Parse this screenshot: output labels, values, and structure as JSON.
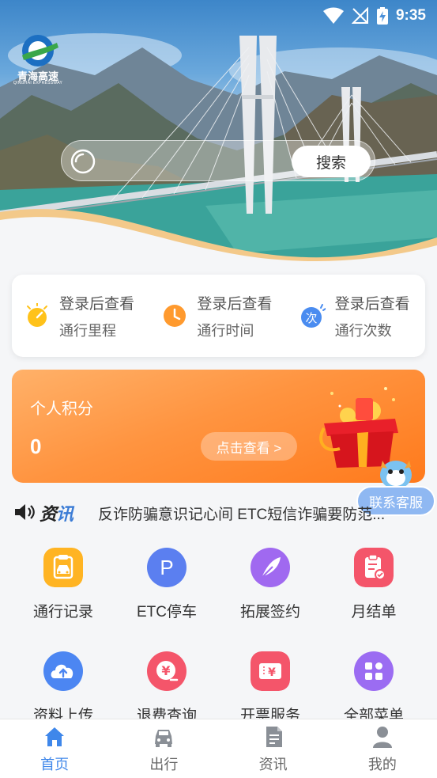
{
  "status_bar": {
    "time": "9:35"
  },
  "brand": {
    "name": "青海高速",
    "subtitle": "QINGHAI EXPRESSWAY"
  },
  "search": {
    "placeholder": "",
    "button_label": "搜索"
  },
  "stats": [
    {
      "icon": "mileage-icon",
      "top": "登录后查看",
      "bottom": "通行里程",
      "color": "#ffc21a"
    },
    {
      "icon": "clock-icon",
      "top": "登录后查看",
      "bottom": "通行时间",
      "color": "#ff9a2e"
    },
    {
      "icon": "count-icon",
      "top": "登录后查看",
      "bottom": "通行次数",
      "color": "#4a8cf0",
      "badge": "次"
    }
  ],
  "points": {
    "title": "个人积分",
    "value": "0",
    "button_label": "点击查看 >"
  },
  "service": {
    "label": "联系客服"
  },
  "news": {
    "tag_left": "资",
    "tag_right": "讯",
    "text": "反诈防骗意识记心间 ETC短信诈骗要防范..."
  },
  "menu": [
    {
      "label": "通行记录",
      "icon": "record-icon",
      "color": "#ffb423"
    },
    {
      "label": "ETC停车",
      "icon": "parking-icon",
      "color": "#5b7ff0",
      "glyph": "P"
    },
    {
      "label": "拓展签约",
      "icon": "feather-icon",
      "color": "#a069f0"
    },
    {
      "label": "月结单",
      "icon": "clipboard-icon",
      "color": "#f4556a"
    },
    {
      "label": "资料上传",
      "icon": "cloud-upload-icon",
      "color": "#4c86f2"
    },
    {
      "label": "退费查询",
      "icon": "refund-icon",
      "color": "#f4556a",
      "glyph": "¥"
    },
    {
      "label": "开票服务",
      "icon": "invoice-icon",
      "color": "#f4556a",
      "glyph": "¥"
    },
    {
      "label": "全部菜单",
      "icon": "all-menu-icon",
      "color": "#9b6cf2"
    }
  ],
  "bottom_nav": [
    {
      "label": "首页",
      "icon": "home-icon",
      "active": true
    },
    {
      "label": "出行",
      "icon": "car-icon",
      "active": false
    },
    {
      "label": "资讯",
      "icon": "news-icon",
      "active": false
    },
    {
      "label": "我的",
      "icon": "user-icon",
      "active": false
    }
  ],
  "colors": {
    "accent": "#3f87ea",
    "points_orange": "#ff8a30",
    "nav_inactive": "#999999"
  }
}
